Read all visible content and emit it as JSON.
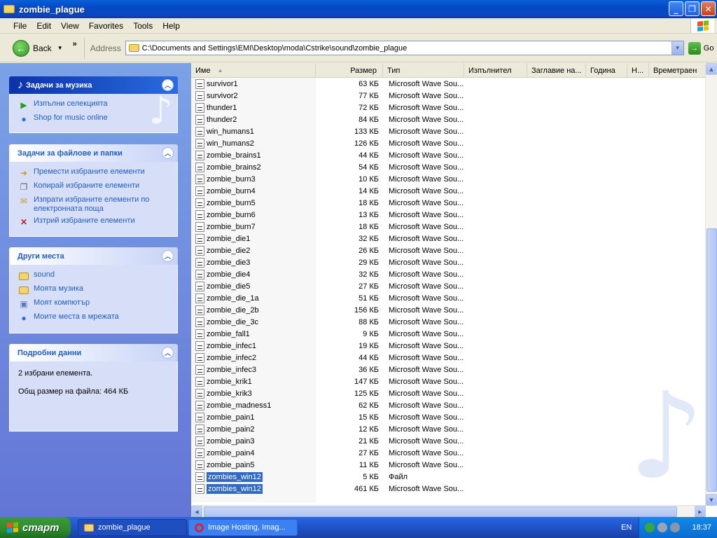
{
  "window": {
    "title": "zombie_plague"
  },
  "menu": [
    "File",
    "Edit",
    "View",
    "Favorites",
    "Tools",
    "Help"
  ],
  "toolbar": {
    "back_label": "Back",
    "address_label": "Address",
    "address_value": "C:\\Documents and Settings\\EMI\\Desktop\\moda\\Cstrike\\sound\\zombie_plague",
    "go_label": "Go"
  },
  "sidebar": {
    "music_tasks": {
      "title": "Задачи за музика",
      "items": [
        "Изпълни селекцията",
        "Shop for music online"
      ]
    },
    "file_tasks": {
      "title": "Задачи за файлове и папки",
      "items": [
        "Премести избраните елементи",
        "Копирай избраните елементи",
        "Изпрати избраните елементи по електронната поща",
        "Изтрий избраните елементи"
      ]
    },
    "other_places": {
      "title": "Други места",
      "items": [
        "sound",
        "Моята музика",
        "Моят компютър",
        "Моите места в мрежата"
      ]
    },
    "details": {
      "title": "Подробни данни",
      "line1": "2 избрани елемента.",
      "line2": "Общ размер на файла: 464 КБ"
    }
  },
  "columns": [
    "Име",
    "Размер",
    "Тип",
    "Изпълнител",
    "Заглавие на...",
    "Година",
    "Н...",
    "Времетраен"
  ],
  "files": [
    {
      "name": "survivor1",
      "size": "63 КБ",
      "type": "Microsoft Wave Sou..."
    },
    {
      "name": "survivor2",
      "size": "77 КБ",
      "type": "Microsoft Wave Sou..."
    },
    {
      "name": "thunder1",
      "size": "72 КБ",
      "type": "Microsoft Wave Sou..."
    },
    {
      "name": "thunder2",
      "size": "84 КБ",
      "type": "Microsoft Wave Sou..."
    },
    {
      "name": "win_humans1",
      "size": "133 КБ",
      "type": "Microsoft Wave Sou..."
    },
    {
      "name": "win_humans2",
      "size": "126 КБ",
      "type": "Microsoft Wave Sou..."
    },
    {
      "name": "zombie_brains1",
      "size": "44 КБ",
      "type": "Microsoft Wave Sou..."
    },
    {
      "name": "zombie_brains2",
      "size": "54 КБ",
      "type": "Microsoft Wave Sou..."
    },
    {
      "name": "zombie_burn3",
      "size": "10 КБ",
      "type": "Microsoft Wave Sou..."
    },
    {
      "name": "zombie_burn4",
      "size": "14 КБ",
      "type": "Microsoft Wave Sou..."
    },
    {
      "name": "zombie_burn5",
      "size": "18 КБ",
      "type": "Microsoft Wave Sou..."
    },
    {
      "name": "zombie_burn6",
      "size": "13 КБ",
      "type": "Microsoft Wave Sou..."
    },
    {
      "name": "zombie_burn7",
      "size": "18 КБ",
      "type": "Microsoft Wave Sou..."
    },
    {
      "name": "zombie_die1",
      "size": "32 КБ",
      "type": "Microsoft Wave Sou..."
    },
    {
      "name": "zombie_die2",
      "size": "26 КБ",
      "type": "Microsoft Wave Sou..."
    },
    {
      "name": "zombie_die3",
      "size": "29 КБ",
      "type": "Microsoft Wave Sou..."
    },
    {
      "name": "zombie_die4",
      "size": "32 КБ",
      "type": "Microsoft Wave Sou..."
    },
    {
      "name": "zombie_die5",
      "size": "27 КБ",
      "type": "Microsoft Wave Sou..."
    },
    {
      "name": "zombie_die_1a",
      "size": "51 КБ",
      "type": "Microsoft Wave Sou..."
    },
    {
      "name": "zombie_die_2b",
      "size": "156 КБ",
      "type": "Microsoft Wave Sou..."
    },
    {
      "name": "zombie_die_3c",
      "size": "88 КБ",
      "type": "Microsoft Wave Sou..."
    },
    {
      "name": "zombie_fall1",
      "size": "9 КБ",
      "type": "Microsoft Wave Sou..."
    },
    {
      "name": "zombie_infec1",
      "size": "19 КБ",
      "type": "Microsoft Wave Sou..."
    },
    {
      "name": "zombie_infec2",
      "size": "44 КБ",
      "type": "Microsoft Wave Sou..."
    },
    {
      "name": "zombie_infec3",
      "size": "36 КБ",
      "type": "Microsoft Wave Sou..."
    },
    {
      "name": "zombie_krik1",
      "size": "147 КБ",
      "type": "Microsoft Wave Sou..."
    },
    {
      "name": "zombie_krik3",
      "size": "125 КБ",
      "type": "Microsoft Wave Sou..."
    },
    {
      "name": "zombie_madness1",
      "size": "62 КБ",
      "type": "Microsoft Wave Sou..."
    },
    {
      "name": "zombie_pain1",
      "size": "15 КБ",
      "type": "Microsoft Wave Sou..."
    },
    {
      "name": "zombie_pain2",
      "size": "12 КБ",
      "type": "Microsoft Wave Sou..."
    },
    {
      "name": "zombie_pain3",
      "size": "21 КБ",
      "type": "Microsoft Wave Sou..."
    },
    {
      "name": "zombie_pain4",
      "size": "27 КБ",
      "type": "Microsoft Wave Sou..."
    },
    {
      "name": "zombie_pain5",
      "size": "11 КБ",
      "type": "Microsoft Wave Sou..."
    },
    {
      "name": "zombies_win12",
      "size": "5 КБ",
      "type": "Файл",
      "selected": true
    },
    {
      "name": "zombies_win12",
      "size": "461 КБ",
      "type": "Microsoft Wave Sou...",
      "selected": true
    }
  ],
  "taskbar": {
    "start_label": "старт",
    "tasks": [
      "zombie_plague",
      "Image Hosting, Imag..."
    ],
    "lang": "EN",
    "clock": "18:37"
  },
  "icons": {
    "music_tasks": "music-note-icon",
    "collapse": "chevron-up-icon",
    "wave_file": "wave-file-icon"
  }
}
